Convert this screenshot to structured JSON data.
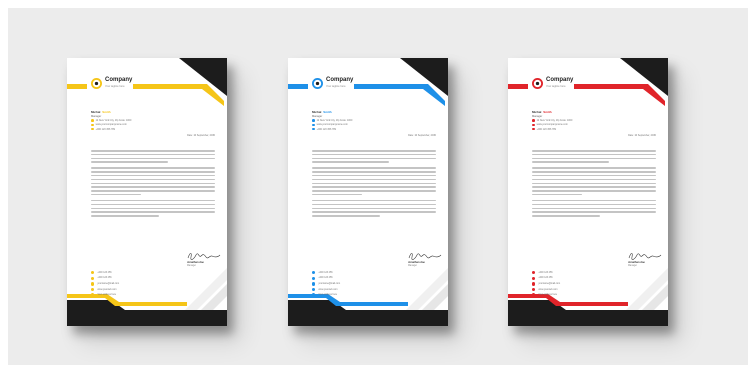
{
  "letterheads": [
    {
      "accent": "#f5c518",
      "company": "Company",
      "tagline": "Your tagline here",
      "recipient_first": "Michal",
      "recipient_last": "Smith",
      "recipient_role": "Manager",
      "address_lines": [
        "12 New York City, Zip Code: 1000",
        "www.yourcompanyname.com",
        "+000 123 456 789"
      ],
      "date": "Date: 10 September, 2030",
      "signer": "Jonathan doe",
      "signer_role": "Manager",
      "signature_glyph": "signature-scribble",
      "contacts": [
        "+000 123 456",
        "+000 123 456",
        "yourname@mail.com",
        "www.yourweb.com",
        "Your address here"
      ]
    },
    {
      "accent": "#1e90e8",
      "company": "Company",
      "tagline": "Your tagline here",
      "recipient_first": "Michal",
      "recipient_last": "Smith",
      "recipient_role": "Manager",
      "address_lines": [
        "12 New York City, Zip Code: 1000",
        "www.yourcompanyname.com",
        "+000 123 456 789"
      ],
      "date": "Date: 10 September, 2030",
      "signer": "Jonathan doe",
      "signer_role": "Manager",
      "signature_glyph": "signature-scribble",
      "contacts": [
        "+000 123 456",
        "+000 123 456",
        "yourname@mail.com",
        "www.yourweb.com",
        "Your address here"
      ]
    },
    {
      "accent": "#e0242a",
      "company": "Company",
      "tagline": "Your tagline here",
      "recipient_first": "Michal",
      "recipient_last": "Smith",
      "recipient_role": "Manager",
      "address_lines": [
        "12 New York City, Zip Code: 1000",
        "www.yourcompanyname.com",
        "+000 123 456 789"
      ],
      "date": "Date: 10 September, 2030",
      "signer": "Jonathan doe",
      "signer_role": "Manager",
      "signature_glyph": "signature-scribble",
      "contacts": [
        "+000 123 456",
        "+000 123 456",
        "yourname@mail.com",
        "www.yourweb.com",
        "Your address here"
      ]
    }
  ],
  "colors": {
    "dark": "#1c1c1c",
    "background": "#ececec"
  }
}
